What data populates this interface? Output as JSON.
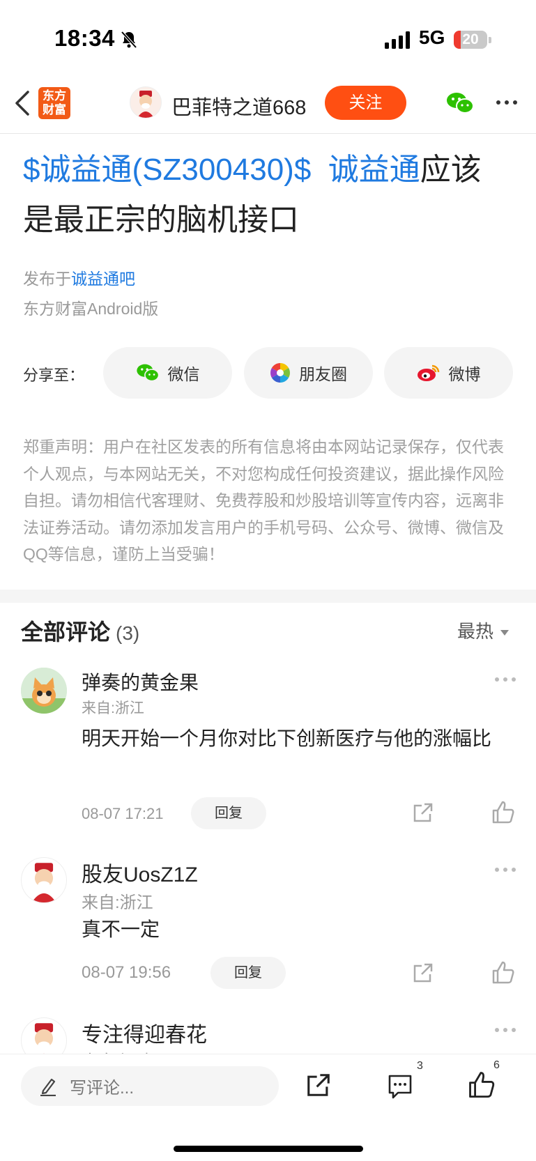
{
  "status": {
    "time": "18:34",
    "network": "5G",
    "battery": "20"
  },
  "nav": {
    "logo_line1": "东方",
    "logo_line2": "财富",
    "user_name": "巴菲特之道668",
    "follow_label": "关注"
  },
  "post": {
    "title_link1": "$诚益通(SZ300430)$",
    "title_link2": "诚益通",
    "title_rest1": "应该",
    "title_line2": "是最正宗的脑机接口",
    "published_prefix": "发布于",
    "published_bar": "诚益通吧",
    "client": "东方财富Android版"
  },
  "share": {
    "label": "分享至：",
    "wechat": "微信",
    "moments": "朋友圈",
    "weibo": "微博"
  },
  "disclaimer": "郑重声明：用户在社区发表的所有信息将由本网站记录保存，仅代表个人观点，与本网站无关，不对您构成任何投资建议，据此操作风险自担。请勿相信代客理财、免费荐股和炒股培训等宣传内容，远离非法证券活动。请勿添加发言用户的手机号码、公众号、微博、微信及QQ等信息，谨防上当受骗！",
  "comments": {
    "title": "全部评论",
    "count": "(3)",
    "sort": "最热",
    "reply_label": "回复",
    "items": [
      {
        "name": "弹奏的黄金果",
        "from": "来自:浙江",
        "text": "明天开始一个月你对比下创新医疗与他的涨幅比",
        "time": "08-07 17:21"
      },
      {
        "name": "股友UosZ1Z",
        "from": "来自:浙江",
        "text": "真不一定",
        "time": "08-07 19:56"
      },
      {
        "name": "专注得迎春花",
        "from": "来自:福建"
      }
    ]
  },
  "bottom": {
    "comment_placeholder": "写评论...",
    "comment_count": "3",
    "like_count": "6"
  }
}
